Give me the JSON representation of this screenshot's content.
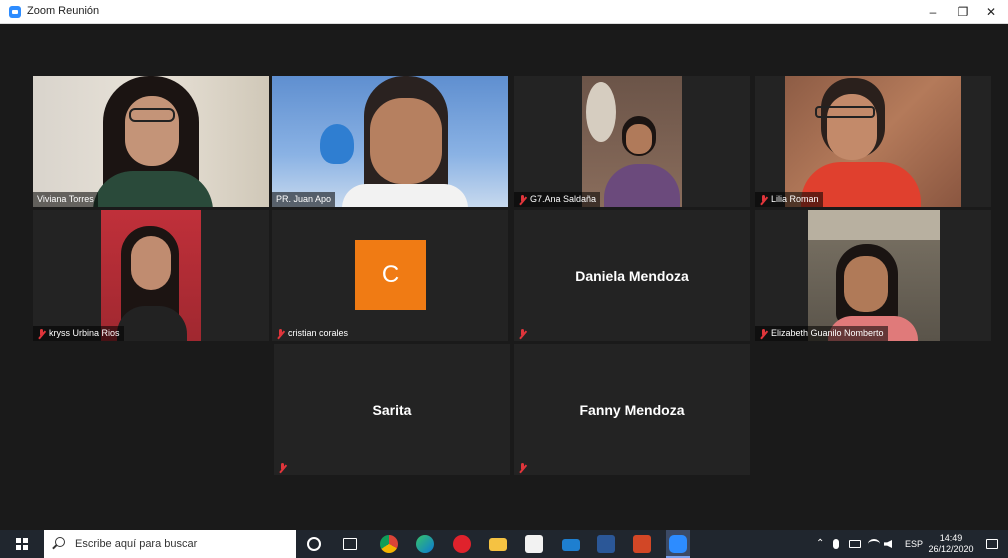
{
  "window": {
    "title": "Zoom Reunión",
    "minimize": "–",
    "maximize": "❐",
    "close": "✕"
  },
  "participants": [
    {
      "id": "viviana",
      "name": "Viviana Torres",
      "muted": false
    },
    {
      "id": "juan",
      "name": "PR. Juan Apo",
      "muted": false,
      "active_speaker": true
    },
    {
      "id": "ana",
      "name": "G7.Ana Saldaña",
      "muted": true
    },
    {
      "id": "lilia",
      "name": "Lilia Roman",
      "muted": true
    },
    {
      "id": "kryss",
      "name": "kryss Urbina Rios",
      "muted": true
    },
    {
      "id": "cristian",
      "name": "cristian corales",
      "muted": true,
      "avatar_letter": "C",
      "avatar_color": "#f07b14"
    },
    {
      "id": "daniela",
      "name": "Daniela Mendoza",
      "muted": true,
      "video_off": true
    },
    {
      "id": "elizabeth",
      "name": "Elizabeth Guanilo Nomberto",
      "muted": true
    },
    {
      "id": "sarita",
      "name": "Sarita",
      "muted": true,
      "video_off": true
    },
    {
      "id": "fanny",
      "name": "Fanny Mendoza",
      "muted": true,
      "video_off": true
    }
  ],
  "colors": {
    "active_speaker_border": "#a8d46a",
    "mute_red": "#e0353b",
    "background": "#1a1a1a",
    "tile": "#232323"
  },
  "taskbar": {
    "search_placeholder": "Escribe aquí para buscar",
    "language": "ESP",
    "time": "14:49",
    "date": "26/12/2020",
    "apps": [
      "cortana-icon",
      "task-view-icon",
      "chrome-icon",
      "edge-icon",
      "opera-icon",
      "file-explorer-icon",
      "store-icon",
      "mail-icon",
      "word-icon",
      "powerpoint-icon",
      "zoom-icon"
    ]
  }
}
